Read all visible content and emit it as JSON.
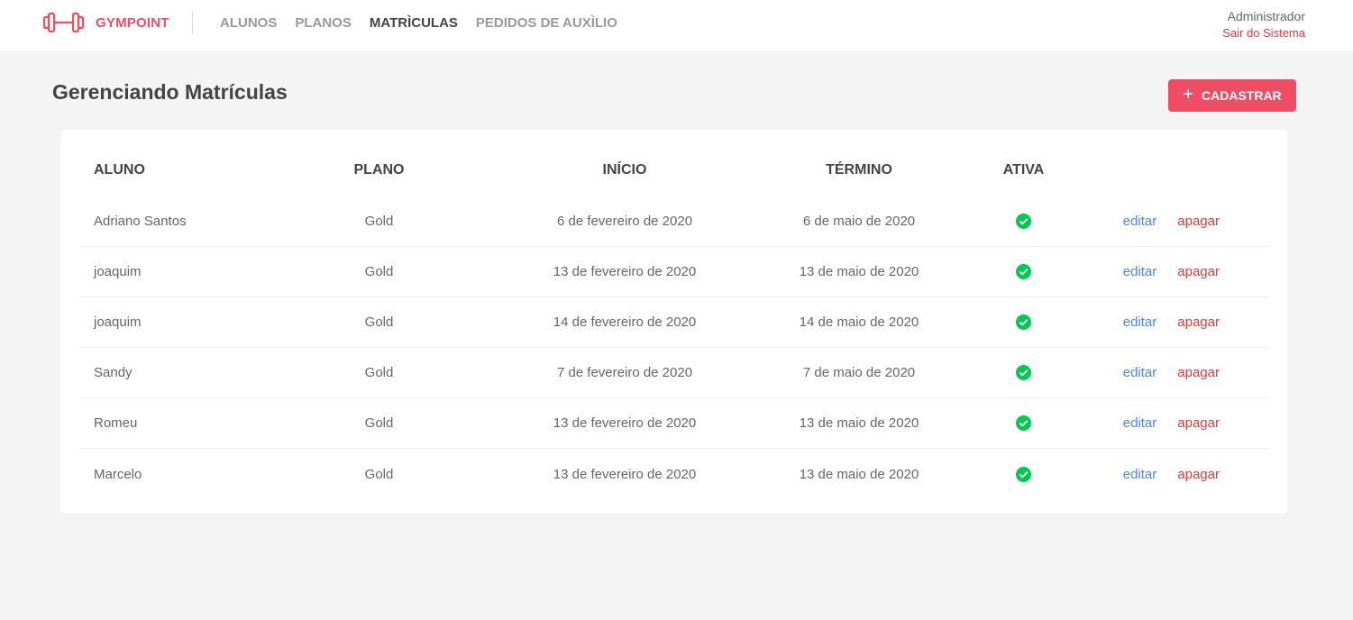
{
  "brand": {
    "name": "GYMPOINT"
  },
  "nav": {
    "items": [
      {
        "label": "ALUNOS"
      },
      {
        "label": "PLANOS"
      },
      {
        "label": "MATRÌCULAS",
        "active": true
      },
      {
        "label": "PEDIDOS DE AUXÌLIO"
      }
    ]
  },
  "user": {
    "name": "Administrador",
    "logout": "Sair do Sistema"
  },
  "page": {
    "title": "Gerenciando Matrículas",
    "add_button": "CADASTRAR"
  },
  "colors": {
    "accent": "#ee4d64",
    "active_check": "#00c853",
    "edit": "#4d85ee",
    "delete": "#de3b3b"
  },
  "table": {
    "headers": {
      "student": "ALUNO",
      "plan": "PLANO",
      "start": "INÍCIO",
      "end": "TÉRMINO",
      "active": "ATIVA"
    },
    "actions": {
      "edit": "editar",
      "delete": "apagar"
    },
    "rows": [
      {
        "student": "Adriano Santos",
        "plan": "Gold",
        "start": "6 de fevereiro de 2020",
        "end": "6 de maio de 2020",
        "active": true
      },
      {
        "student": "joaquim",
        "plan": "Gold",
        "start": "13 de fevereiro de 2020",
        "end": "13 de maio de 2020",
        "active": true
      },
      {
        "student": "joaquim",
        "plan": "Gold",
        "start": "14 de fevereiro de 2020",
        "end": "14 de maio de 2020",
        "active": true
      },
      {
        "student": "Sandy",
        "plan": "Gold",
        "start": "7 de fevereiro de 2020",
        "end": "7 de maio de 2020",
        "active": true
      },
      {
        "student": "Romeu",
        "plan": "Gold",
        "start": "13 de fevereiro de 2020",
        "end": "13 de maio de 2020",
        "active": true
      },
      {
        "student": "Marcelo",
        "plan": "Gold",
        "start": "13 de fevereiro de 2020",
        "end": "13 de maio de 2020",
        "active": true
      }
    ]
  }
}
